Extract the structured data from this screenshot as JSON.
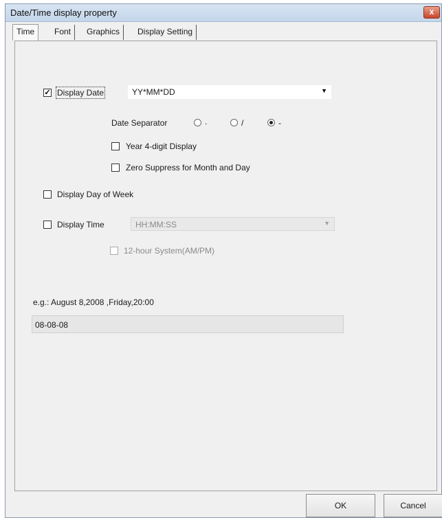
{
  "window": {
    "title": "Date/Time display property",
    "close_label": "x"
  },
  "tabs": [
    {
      "label": "Time"
    },
    {
      "label": "Font"
    },
    {
      "label": "Graphics"
    },
    {
      "label": "Display Setting"
    }
  ],
  "display_date": {
    "checked": true,
    "check_mark": "✓",
    "label": "Display Date",
    "format_value": "YY*MM*DD",
    "separator_label": "Date Separator",
    "separator_options": [
      ".",
      "/",
      "-"
    ],
    "separator_selected": "-",
    "year4_label": "Year 4-digit Display",
    "zero_suppress_label": "Zero Suppress for Month and Day"
  },
  "display_day_of_week": {
    "label": "Display Day of Week"
  },
  "display_time": {
    "label": "Display Time",
    "format_value": "HH:MM:SS",
    "hour12_label": "12-hour System(AM/PM)"
  },
  "example": {
    "label": "e.g.: August 8,2008 ,Friday,20:00",
    "preview": "08-08-08"
  },
  "buttons": {
    "ok": "OK",
    "cancel": "Cancel"
  }
}
